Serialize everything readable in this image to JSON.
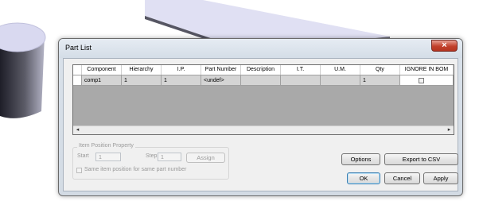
{
  "dialog": {
    "title": "Part List",
    "close_glyph": "×"
  },
  "grid": {
    "columns": [
      "",
      "Component",
      "Hierarchy",
      "I.P.",
      "Part Number",
      "Description",
      "I.T.",
      "U.M.",
      "Qty",
      "IGNORE IN BOM"
    ],
    "rows": [
      {
        "component": "comp1",
        "hierarchy": "1",
        "ip": "1",
        "part_number": "<undef>",
        "description": "",
        "it": "",
        "um": "",
        "qty": "1",
        "ignore_in_bom": false
      }
    ],
    "scroll_left_glyph": "◂",
    "scroll_right_glyph": "▸"
  },
  "item_position": {
    "group_title": "Item Position Property",
    "start_label": "Start",
    "start_value": "1",
    "step_label": "Step",
    "step_value": "1",
    "assign_label": "Assign",
    "same_item_label": "Same item position for same part number"
  },
  "buttons": {
    "options": "Options",
    "export_csv": "Export to CSV",
    "ok": "OK",
    "cancel": "Cancel",
    "apply": "Apply"
  },
  "colors": {
    "close_button": "#c2412c",
    "grid_background": "#a9a9a9",
    "row_background": "#d4d4d4"
  }
}
